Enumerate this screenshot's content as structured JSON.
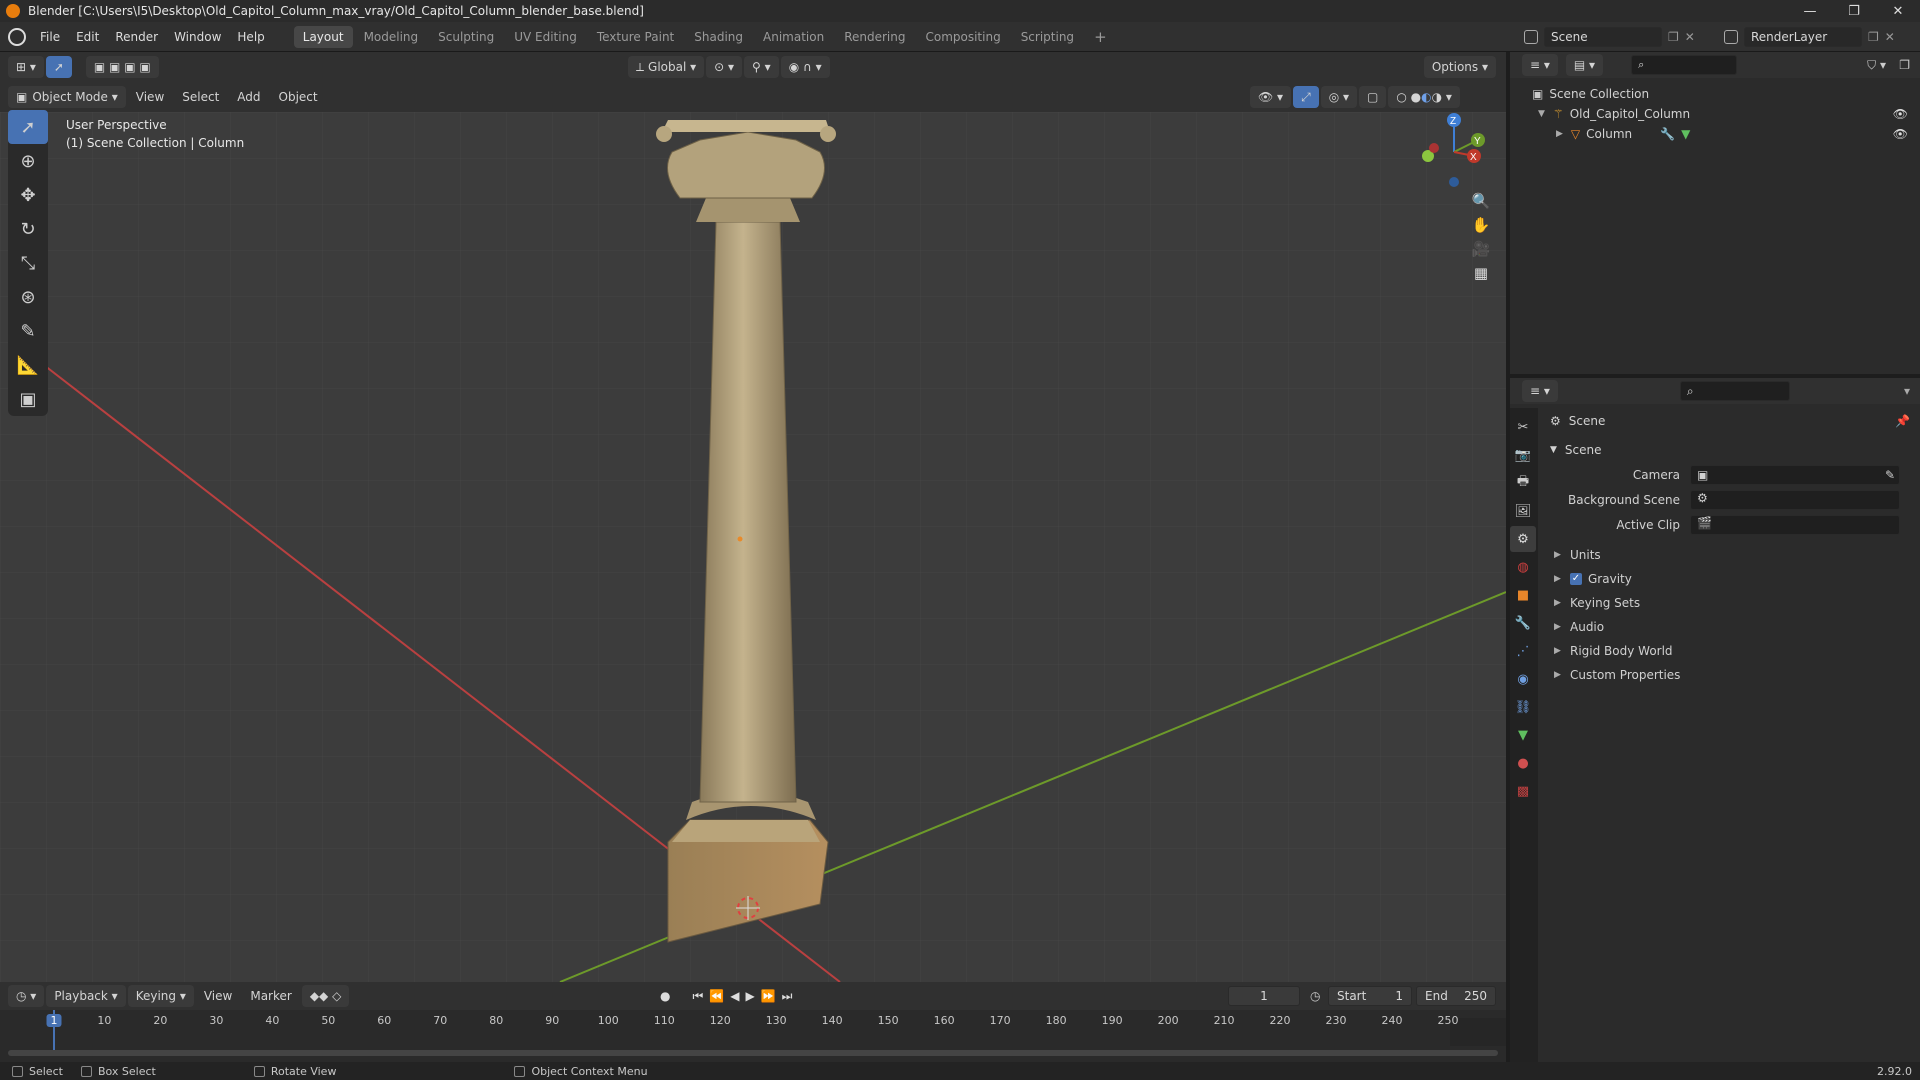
{
  "title": "Blender [C:\\Users\\I5\\Desktop\\Old_Capitol_Column_max_vray/Old_Capitol_Column_blender_base.blend]",
  "menu": [
    "File",
    "Edit",
    "Render",
    "Window",
    "Help"
  ],
  "workspaces": [
    "Layout",
    "Modeling",
    "Sculpting",
    "UV Editing",
    "Texture Paint",
    "Shading",
    "Animation",
    "Rendering",
    "Compositing",
    "Scripting"
  ],
  "active_workspace": "Layout",
  "scene_selector": "Scene",
  "view_layer": "RenderLayer",
  "viewport": {
    "mode": "Object Mode",
    "menus": [
      "View",
      "Select",
      "Add",
      "Object"
    ],
    "orientation": "Global",
    "options": "Options",
    "overlay_line1": "User Perspective",
    "overlay_line2": "(1) Scene Collection | Column",
    "gizmo_axes": [
      "Z",
      "Y",
      "X"
    ]
  },
  "outliner": {
    "root": "Scene Collection",
    "collection": "Old_Capitol_Column",
    "object": "Column"
  },
  "properties": {
    "header": "Scene",
    "section": "Scene",
    "fields": [
      {
        "label": "Camera"
      },
      {
        "label": "Background Scene"
      },
      {
        "label": "Active Clip"
      }
    ],
    "subpanels": [
      "Units",
      "Gravity",
      "Keying Sets",
      "Audio",
      "Rigid Body World",
      "Custom Properties"
    ],
    "gravity_checked": true
  },
  "timeline": {
    "menus": [
      "Playback",
      "Keying",
      "View",
      "Marker"
    ],
    "current_frame": "1",
    "start_label": "Start",
    "start": "1",
    "end_label": "End",
    "end": "250",
    "ticks": [
      "1",
      "10",
      "20",
      "30",
      "40",
      "50",
      "60",
      "70",
      "80",
      "90",
      "100",
      "110",
      "120",
      "130",
      "140",
      "150",
      "160",
      "170",
      "180",
      "190",
      "200",
      "210",
      "220",
      "230",
      "240",
      "250"
    ]
  },
  "statusbar": {
    "items": [
      "Select",
      "Box Select",
      "Rotate View",
      "Object Context Menu"
    ],
    "version": "2.92.0"
  },
  "colors": {
    "accent": "#4772b3",
    "x_axis": "#c0392b",
    "y_axis": "#6d9a2a",
    "z_axis": "#3f7fd6"
  }
}
